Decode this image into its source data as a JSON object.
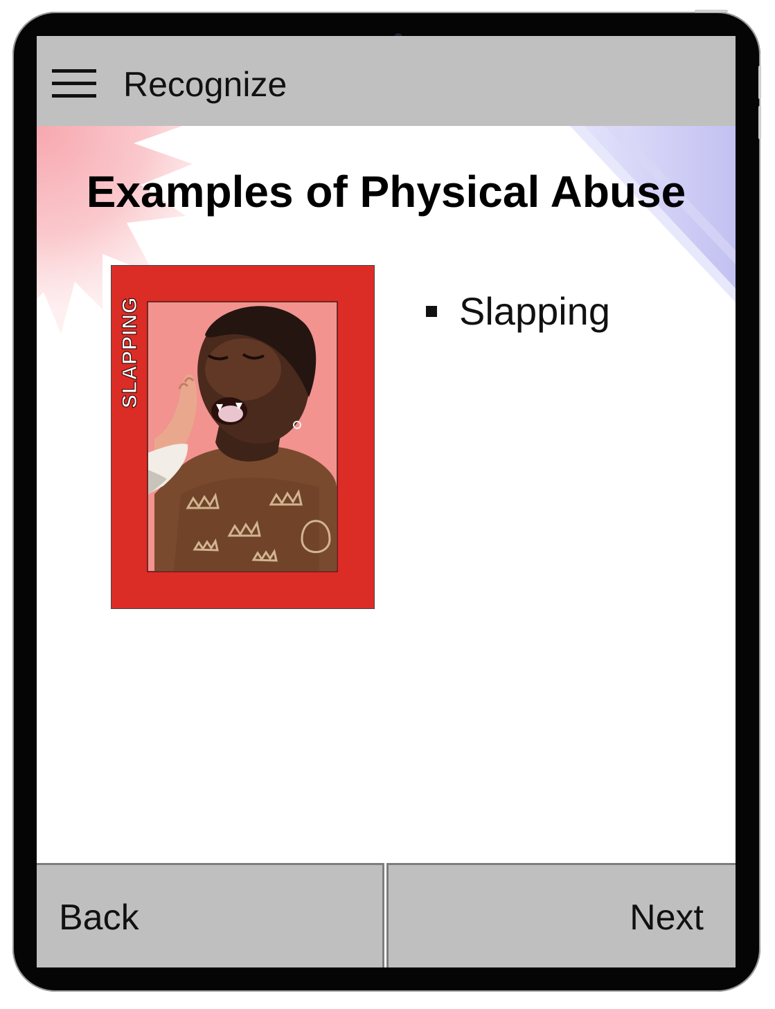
{
  "topbar": {
    "title": "Recognize",
    "menu_icon": "hamburger-menu-icon"
  },
  "content": {
    "heading": "Examples of Physical Abuse",
    "card": {
      "caption": "SLAPPING",
      "image": "man-being-slapped-photo"
    },
    "bullets": [
      "Slapping"
    ]
  },
  "footer": {
    "back_label": "Back",
    "next_label": "Next"
  },
  "colors": {
    "bar_gray": "#c0c0c0",
    "card_red": "#dc2c26",
    "deco_pink": "#f7b7bd",
    "deco_lavender": "#c7c6f2"
  }
}
